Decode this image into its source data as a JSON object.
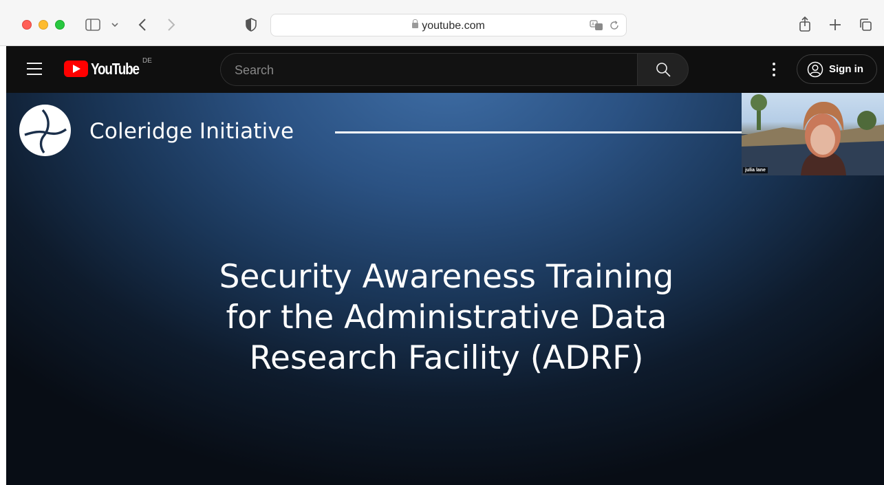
{
  "browser": {
    "address": "youtube.com"
  },
  "youtube": {
    "logo_text": "YouTube",
    "country_code": "DE",
    "search_placeholder": "Search",
    "sign_in_label": "Sign in"
  },
  "video": {
    "organization": "Coleridge Initiative",
    "title_lines": [
      "Security Awareness Training",
      "for the Administrative Data",
      "Research Facility (ADRF)"
    ],
    "presenter_name": "julia lane"
  },
  "colors": {
    "youtube_red": "#ff0000",
    "header_bg": "#0f0f0f",
    "slide_bg": "#1a3658"
  },
  "icons": [
    "sidebar-icon",
    "chevron-down-icon",
    "back-icon",
    "forward-icon",
    "privacy-shield-icon",
    "lock-icon",
    "translate-icon",
    "reload-icon",
    "share-icon",
    "new-tab-icon",
    "tabs-overview-icon",
    "hamburger-menu-icon",
    "search-icon",
    "more-vertical-icon",
    "account-icon"
  ]
}
